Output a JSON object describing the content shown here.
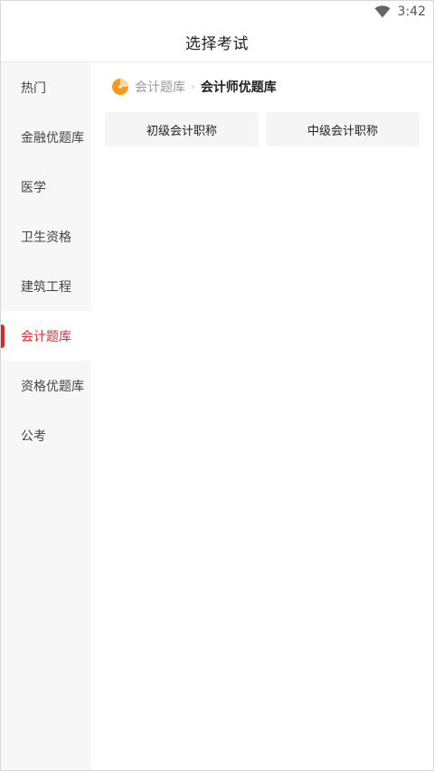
{
  "status_bar": {
    "time": "3:42",
    "icons": [
      "wifi-icon"
    ]
  },
  "header": {
    "title": "选择考试"
  },
  "sidebar": {
    "items": [
      {
        "label": "热门",
        "active": false
      },
      {
        "label": "金融优题库",
        "active": false
      },
      {
        "label": "医学",
        "active": false
      },
      {
        "label": "卫生资格",
        "active": false
      },
      {
        "label": "建筑工程",
        "active": false
      },
      {
        "label": "会计题库",
        "active": true
      },
      {
        "label": "资格优题库",
        "active": false
      },
      {
        "label": "公考",
        "active": false
      }
    ]
  },
  "main": {
    "breadcrumb": {
      "icon": "pie-chart-icon",
      "parent": "会计题库",
      "current": "会计师优题库"
    },
    "options": [
      {
        "label": "初级会计职称"
      },
      {
        "label": "中级会计职称"
      }
    ]
  },
  "colors": {
    "accent_red": "#e02d2d",
    "active_bar": "#d62828",
    "icon_orange": "#f59a23",
    "sidebar_bg": "#f7f7f7",
    "option_bg": "#f5f5f5"
  }
}
